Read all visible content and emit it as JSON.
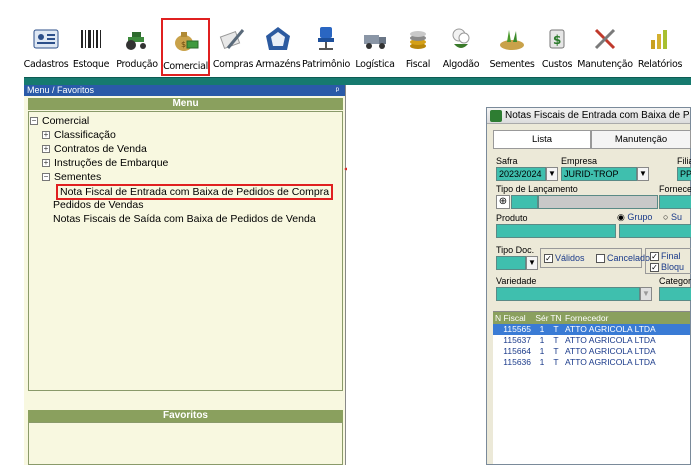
{
  "toolbar": {
    "buttons": [
      {
        "label": "Cadastros",
        "icon": "id-card-icon"
      },
      {
        "label": "Estoque",
        "icon": "barcode-icon"
      },
      {
        "label": "Produção",
        "icon": "tractor-icon"
      },
      {
        "label": "Comercial",
        "icon": "money-bag-icon"
      },
      {
        "label": "Compras",
        "icon": "pen-icon"
      },
      {
        "label": "Armazéns",
        "icon": "warehouse-icon"
      },
      {
        "label": "Patrimônio",
        "icon": "chair-icon"
      },
      {
        "label": "Logística",
        "icon": "truck-icon"
      },
      {
        "label": "Fiscal",
        "icon": "coins-icon"
      },
      {
        "label": "Algodão",
        "icon": "cotton-icon"
      },
      {
        "label": "Sementes",
        "icon": "seeds-icon"
      },
      {
        "label": "Custos",
        "icon": "dollar-icon"
      },
      {
        "label": "Manutenção",
        "icon": "tools-icon"
      },
      {
        "label": "Relatórios",
        "icon": "report-icon"
      }
    ],
    "active": "Comercial"
  },
  "left_panel": {
    "header": "Menu / Favoritos",
    "pin": "ᵖ",
    "menu_title": "Menu",
    "favorites_title": "Favoritos",
    "tree": {
      "root": "Comercial",
      "classificacao": "Classificação",
      "contratos": "Contratos de Venda",
      "instrucoes": "Instruções de Embarque",
      "sementes": "Sementes",
      "nota_fiscal": "Nota Fiscal de Entrada com Baixa de Pedidos de Compra",
      "pedidos": "Pedidos de Vendas",
      "notas_saida": "Notas Fiscais de Saída com Baixa de Pedidos de Venda"
    },
    "toggle_collapse": "−",
    "toggle_expand": "+"
  },
  "window": {
    "title": "Notas Fiscais de Entrada com Baixa  de Pedic",
    "tabs": [
      "Lista",
      "Manutenção"
    ],
    "labels": {
      "safra": "Safra",
      "empresa": "Empresa",
      "filial": "Filial",
      "tipo_lancamento": "Tipo de Lançamento",
      "fornecedor": "Forneced",
      "produto": "Produto",
      "grupo": "Grupo",
      "su": "Su",
      "tipo_doc": "Tipo Doc.",
      "validos": "Válidos",
      "cancelados": "Cancelados",
      "final": "Final",
      "bloq": "Bloqu",
      "variedade": "Variedade",
      "categoria": "Categoria"
    },
    "values": {
      "safra": "2023/2024",
      "empresa": "JURID-TROP",
      "filial": "PPTA"
    },
    "grid": {
      "headers": [
        "N Fiscal",
        "Sér",
        "TN",
        "Fornecedor"
      ],
      "rows": [
        {
          "nf": "115565",
          "ser": "1",
          "tn": "T",
          "fornecedor": "ATTO AGRICOLA LTDA"
        },
        {
          "nf": "115637",
          "ser": "1",
          "tn": "T",
          "fornecedor": "ATTO AGRICOLA LTDA"
        },
        {
          "nf": "115664",
          "ser": "1",
          "tn": "T",
          "fornecedor": "ATTO AGRICOLA LTDA"
        },
        {
          "nf": "115636",
          "ser": "1",
          "tn": "T",
          "fornecedor": "ATTO AGRICOLA LTDA"
        }
      ]
    }
  },
  "colors": {
    "accent_green": "#8aa05e",
    "teal_field": "#3fbfae",
    "highlight_red": "#e02020",
    "selected_row": "#3a7bd5"
  }
}
